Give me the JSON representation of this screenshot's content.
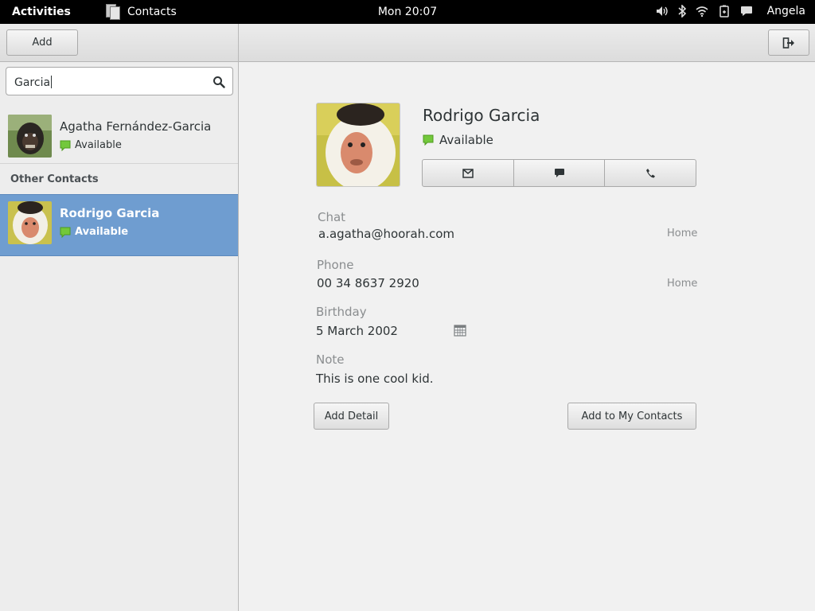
{
  "topbar": {
    "activities": "Activities",
    "app_name": "Contacts",
    "clock": "Mon 20:07",
    "user": "Angela",
    "icons": [
      "volume-icon",
      "bluetooth-icon",
      "wifi-icon",
      "battery-icon",
      "chat-icon"
    ]
  },
  "toolbar": {
    "add_label": "Add",
    "exit_icon": "leave-icon"
  },
  "search": {
    "value": "Garcia",
    "icon": "search-icon"
  },
  "contacts": [
    {
      "name": "Agatha Fernández-Garcia",
      "status": "Available"
    },
    {
      "name": "Rodrigo Garcia",
      "status": "Available",
      "selected": true
    }
  ],
  "section_other": "Other Contacts",
  "detail": {
    "name": "Rodrigo Garcia",
    "status": "Available",
    "action_icons": [
      "mail-icon",
      "chat-bubble-icon",
      "phone-icon"
    ],
    "fields": [
      {
        "label": "Chat",
        "value": "a.agatha@hoorah.com",
        "type": "Home"
      },
      {
        "label": "Phone",
        "value": "00 34 8637 2920",
        "type": "Home"
      },
      {
        "label": "Birthday",
        "value": "5 March 2002"
      },
      {
        "label": "Note",
        "value": "This is one cool kid."
      }
    ],
    "add_detail": "Add Detail",
    "add_to_my_contacts": "Add to My Contacts"
  },
  "colors": {
    "selection": "#6f9dd0",
    "status_available": "#73c83b"
  }
}
